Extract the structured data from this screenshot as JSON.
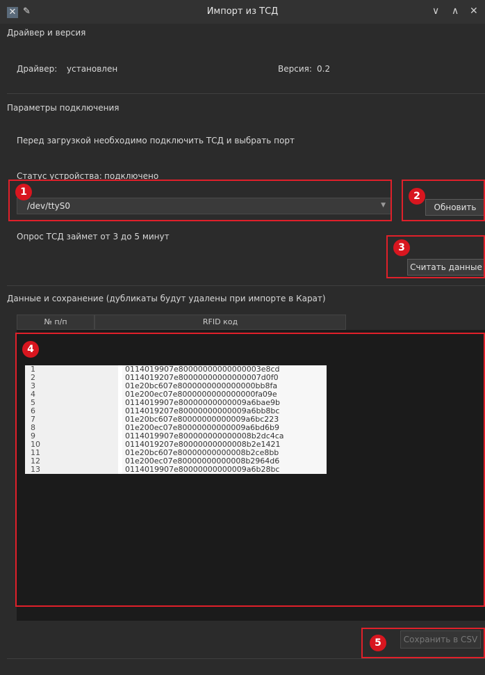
{
  "window": {
    "title": "Импорт из ТСД",
    "controls": [
      "∨",
      "∧",
      "✕"
    ]
  },
  "driver_group": {
    "title": "Драйвер и версия",
    "driver_label": "Драйвер:",
    "driver_value": "установлен",
    "version_label": "Версия:",
    "version_value": "0.2"
  },
  "connection_group": {
    "title": "Параметры подключения",
    "hint": "Перед загрузкой необходимо подключить ТСД и выбрать порт",
    "status_label": "Статус устройства:",
    "status_value": "подключено",
    "port_value": "/dev/ttyS0",
    "refresh_label": "Обновить",
    "poll_note": "Опрос ТСД займет от 3 до 5 минут",
    "read_label": "Считать данные"
  },
  "data_group": {
    "title": "Данные и сохранение (дубликаты будут удалены при импорте в Карат)",
    "columns": [
      "№ п/п",
      "RFID код"
    ],
    "rows": [
      [
        "1",
        "0114019907e80000000000000003e8cd"
      ],
      [
        "2",
        "0114019207e80000000000000007d0f0"
      ],
      [
        "3",
        "01e20bc607e8000000000000000bb8fa"
      ],
      [
        "4",
        "01e200ec07e8000000000000000fa09e"
      ],
      [
        "5",
        "0114019907e80000000000009a6bae9b"
      ],
      [
        "6",
        "0114019207e80000000000009a6bb8bc"
      ],
      [
        "7",
        "01e20bc607e80000000000009a6bc223"
      ],
      [
        "8",
        "01e200ec07e80000000000009a6bd6b9"
      ],
      [
        "9",
        "0114019907e800000000000008b2dc4ca"
      ],
      [
        "10",
        "0114019207e80000000000008b2e1421"
      ],
      [
        "11",
        "01e20bc607e80000000000008b2ce8bb"
      ],
      [
        "12",
        "01e200ec07e80000000000008b2964d6"
      ],
      [
        "13",
        "0114019907e80000000000009a6b28bc"
      ]
    ],
    "save_label": "Сохранить в CSV"
  },
  "annotations": [
    "1",
    "2",
    "3",
    "4",
    "5"
  ],
  "colors": {
    "annotation": "#e0202a",
    "background": "#2b2b2b"
  }
}
